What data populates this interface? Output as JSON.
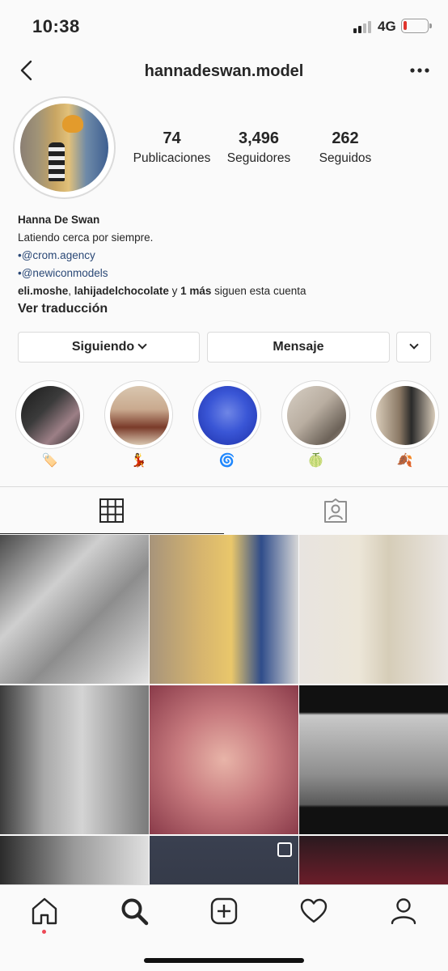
{
  "status_bar": {
    "time": "10:38",
    "network": "4G"
  },
  "header": {
    "username": "hannadeswan.model",
    "back_icon": "chevron-left-icon",
    "more_icon": "ellipsis-icon"
  },
  "stats": [
    {
      "value": "74",
      "label": "Publicaciones"
    },
    {
      "value": "3,496",
      "label": "Seguidores"
    },
    {
      "value": "262",
      "label": "Seguidos"
    }
  ],
  "bio": {
    "name": "Hanna De Swan",
    "tagline": "Latiendo cerca por siempre.",
    "link1": "•@crom.agency",
    "link2": "•@newiconmodels",
    "followed_by_a": "eli.moshe",
    "followed_by_sep": ", ",
    "followed_by_b": "lahijadelchocolate",
    "followed_by_mid": " y ",
    "followed_by_more": "1 más",
    "followed_by_tail": " siguen esta cuenta",
    "translate": "Ver traducción"
  },
  "actions": {
    "following": "Siguiendo",
    "message": "Mensaje"
  },
  "highlights": [
    {
      "emoji": "🏷️",
      "color_a": "#2b2b2b",
      "color_b": "#9c7f86"
    },
    {
      "emoji": "💃",
      "color_a": "#7a3b2a",
      "color_b": "#d9c7b0"
    },
    {
      "emoji": "🌀",
      "color_a": "#1c2fa8",
      "color_b": "#3a56d6"
    },
    {
      "emoji": "🍈",
      "color_a": "#b9aea1",
      "color_b": "#6c6258"
    },
    {
      "emoji": "🍂",
      "color_a": "#8a7864",
      "color_b": "#d8cbb9"
    }
  ],
  "tabs": [
    {
      "name": "grid",
      "icon": "grid-icon",
      "active": true
    },
    {
      "name": "tagged",
      "icon": "tagged-user-icon",
      "active": false
    }
  ],
  "posts": [
    {
      "desc": "bw portrait lying",
      "bg": "linear-gradient(135deg,#4a4a4a 0%,#cfcfcf 35%,#8d8d8d 60%,#e4e4e4 100%)"
    },
    {
      "desc": "graffiti wall heart",
      "bg": "linear-gradient(90deg,#a7947b 0%,#d7b56e 35%,#e9c76b 55%,#2f4c8a 75%,#d8d8d8 100%)"
    },
    {
      "desc": "purple hair sweater",
      "bg": "linear-gradient(90deg,#e8e4e0 0%,#ece6d8 40%,#d6cdb8 60%,#eae6e2 100%)"
    },
    {
      "desc": "bw floral shirt window",
      "bg": "linear-gradient(90deg,#3c3c3c 0%,#a9a9a9 30%,#d4d4d4 55%,#7a7a7a 100%)"
    },
    {
      "desc": "pink curly hair",
      "bg": "radial-gradient(circle at 50% 50%,#e8b4a8 0%,#c77a7e 45%,#8a3b4a 100%)"
    },
    {
      "desc": "street hoodie",
      "bg": "linear-gradient(180deg,#111 0%,#111 18%,#c9c9c9 20%,#8e8e8e 60%,#5a5a5a 80%,#111 82%,#111 100%)"
    },
    {
      "desc": "bw short hair",
      "bg": "linear-gradient(90deg,#2b2b2b 0%,#9a9a9a 50%,#e0e0e0 100%)"
    },
    {
      "desc": "dark texture",
      "bg": "linear-gradient(180deg,#3a4050 0%,#2b303b 100%)",
      "badge": true
    },
    {
      "desc": "red top dancer",
      "bg": "linear-gradient(180deg,#2a1a1f 0%,#7a1e2c 40%,#c4283f 60%,#3a1016 100%)"
    }
  ],
  "bottom_nav": [
    {
      "name": "home",
      "icon": "home-icon"
    },
    {
      "name": "search",
      "icon": "search-icon"
    },
    {
      "name": "new-post",
      "icon": "add-post-icon"
    },
    {
      "name": "activity",
      "icon": "heart-icon"
    },
    {
      "name": "profile",
      "icon": "profile-icon"
    }
  ]
}
